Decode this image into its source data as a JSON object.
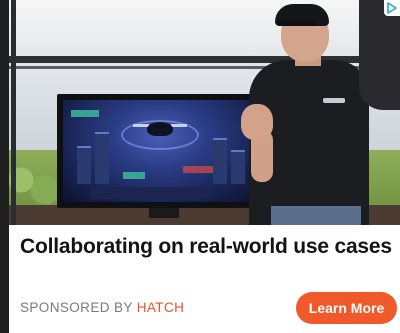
{
  "ad": {
    "headline": "Collaborating on real-world use cases",
    "sponsor_prefix": "SPONSORED BY",
    "sponsor_name": "HATCH",
    "cta_label": "Learn More",
    "corner_icon": "adchoices-icon"
  },
  "colors": {
    "accent": "#f0592a",
    "sponsor_name": "#e8542c",
    "headline": "#141414",
    "sponsor_prefix": "#7a7a7a"
  }
}
